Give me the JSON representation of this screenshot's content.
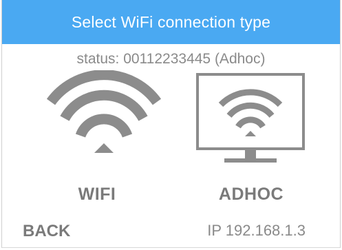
{
  "header": {
    "title": "Select WiFi connection type"
  },
  "status": {
    "text": "status: 00112233445 (Adhoc)"
  },
  "options": [
    {
      "label": "WIFI",
      "icon": "wifi-icon"
    },
    {
      "label": "ADHOC",
      "icon": "monitor-wifi-icon"
    }
  ],
  "footer": {
    "back_label": "BACK",
    "ip_text": "IP 192.168.1.3"
  },
  "colors": {
    "header_bg": "#4aa9f2",
    "header_text": "#ffffff",
    "icon_gray": "#8c8c8c",
    "text_gray": "#7a7a7a"
  }
}
